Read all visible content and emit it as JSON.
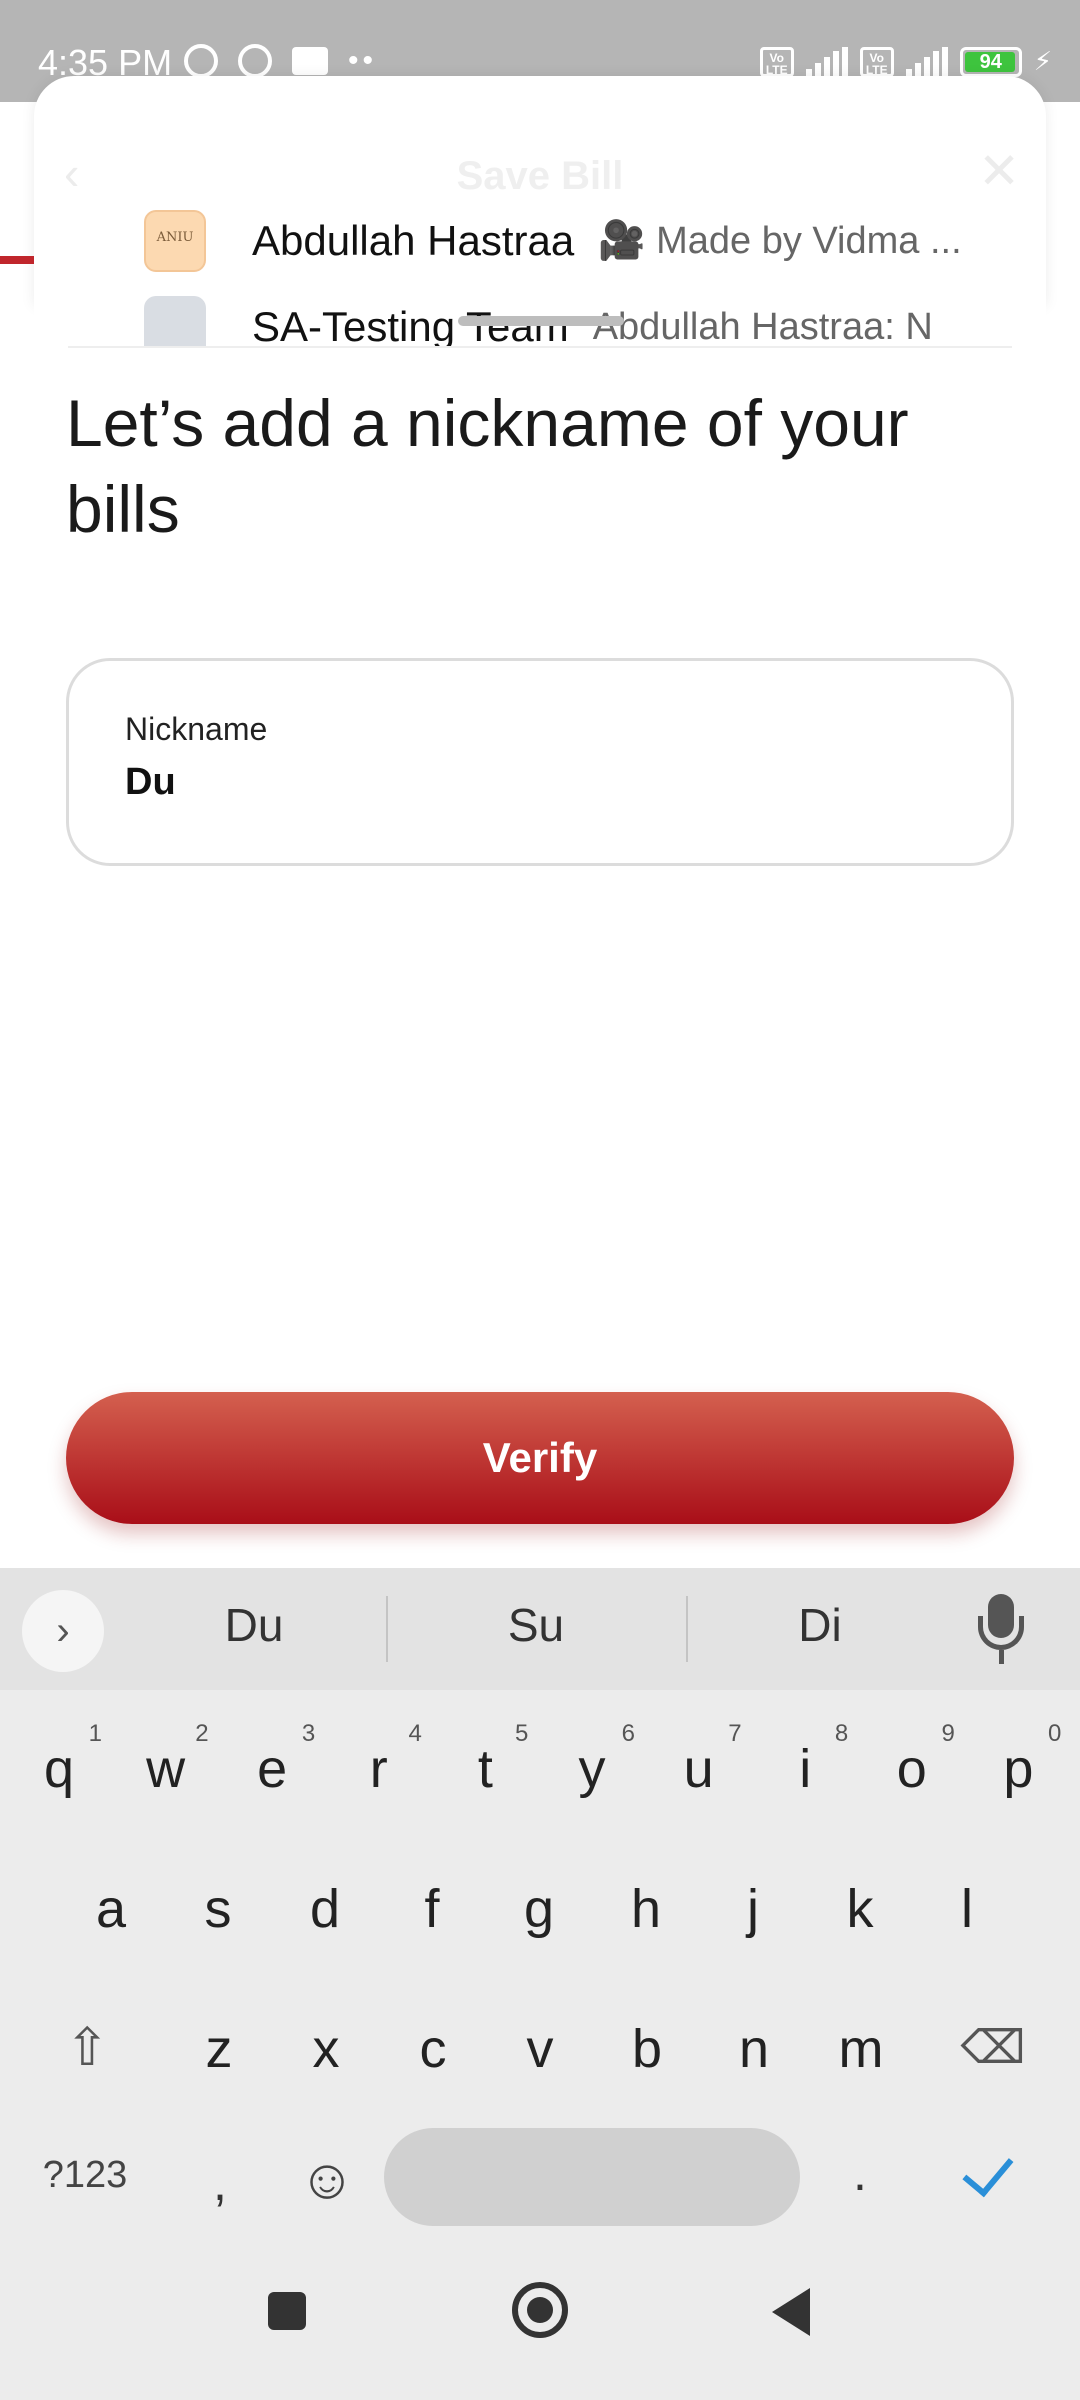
{
  "status_bar": {
    "time": "4:35 PM",
    "battery": "94",
    "network": "4G+"
  },
  "background_dialog": {
    "title": "Save Bill"
  },
  "share_panel": {
    "rows": [
      {
        "avatar_text": "ANIU",
        "name": "Abdullah Hastraa",
        "message": "🎥 Made by Vidma ..."
      },
      {
        "avatar_text": "",
        "name": "SA-Testing Team",
        "message": "Abdullah Hastraa: N"
      }
    ]
  },
  "main": {
    "heading": "Let’s add a nickname of your bills",
    "nickname_field": {
      "label": "Nickname",
      "value": "Du"
    },
    "verify_label": "Verify"
  },
  "keyboard": {
    "suggestions": [
      "Du",
      "Su",
      "Di"
    ],
    "row1": [
      {
        "k": "q",
        "n": "1"
      },
      {
        "k": "w",
        "n": "2"
      },
      {
        "k": "e",
        "n": "3"
      },
      {
        "k": "r",
        "n": "4"
      },
      {
        "k": "t",
        "n": "5"
      },
      {
        "k": "y",
        "n": "6"
      },
      {
        "k": "u",
        "n": "7"
      },
      {
        "k": "i",
        "n": "8"
      },
      {
        "k": "o",
        "n": "9"
      },
      {
        "k": "p",
        "n": "0"
      }
    ],
    "row2": [
      "a",
      "s",
      "d",
      "f",
      "g",
      "h",
      "j",
      "k",
      "l"
    ],
    "row3": [
      "z",
      "x",
      "c",
      "v",
      "b",
      "n",
      "m"
    ],
    "symbols_label": "?123",
    "comma": ",",
    "period": "."
  }
}
